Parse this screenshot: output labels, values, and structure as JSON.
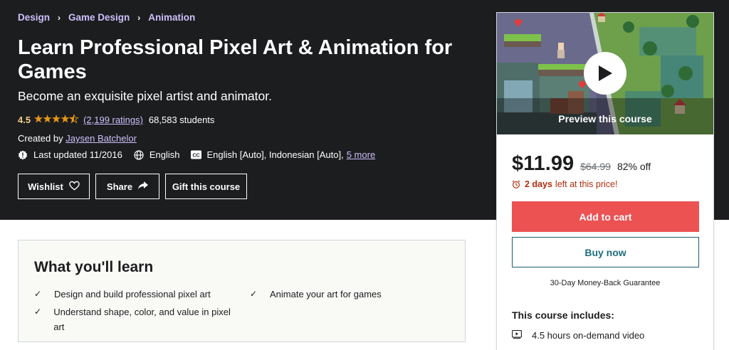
{
  "breadcrumb": [
    "Design",
    "Game Design",
    "Animation"
  ],
  "course": {
    "title": "Learn Professional Pixel Art & Animation for Games",
    "subtitle": "Become an exquisite pixel artist and animator.",
    "rating": "4.5",
    "stars_value": 4.5,
    "ratings_count": "(2,199 ratings)",
    "students": "68,583 students",
    "created_by_label": "Created by",
    "author": "Jaysen Batchelor",
    "last_updated": "Last updated 11/2016",
    "language": "English",
    "captions": "English [Auto], Indonesian [Auto],",
    "more_captions": "5 more"
  },
  "actions": {
    "wishlist": "Wishlist",
    "share": "Share",
    "gift": "Gift this course"
  },
  "learn": {
    "title": "What you'll learn",
    "items": [
      "Design and build professional pixel art",
      "Animate your art for games",
      "Understand shape, color, and value in pixel art"
    ]
  },
  "card": {
    "preview_label": "Preview this course",
    "price": "$11.99",
    "original_price": "$64.99",
    "discount": "82% off",
    "timer_bold": "2 days",
    "timer_rest": "left at this price!",
    "add_to_cart": "Add to cart",
    "buy_now": "Buy now",
    "guarantee": "30-Day Money-Back Guarantee",
    "includes_title": "This course includes:",
    "includes": [
      "4.5 hours on-demand video"
    ]
  },
  "icons": {
    "heart": "heart-icon",
    "share": "share-arrow-icon",
    "alarm": "alarm-icon",
    "globe": "globe-icon",
    "captions": "closed-captions-icon",
    "updated": "alert-badge-icon",
    "check": "check-icon",
    "video": "video-icon",
    "play": "play-icon"
  },
  "colors": {
    "hero_bg": "#1c1d1f",
    "link_purple": "#cec0fc",
    "star": "#e59819",
    "rating_text": "#f3ca8c",
    "cart_red": "#ec5252",
    "timer_red": "#b32d0f",
    "buy_border": "#1e6d7e"
  }
}
